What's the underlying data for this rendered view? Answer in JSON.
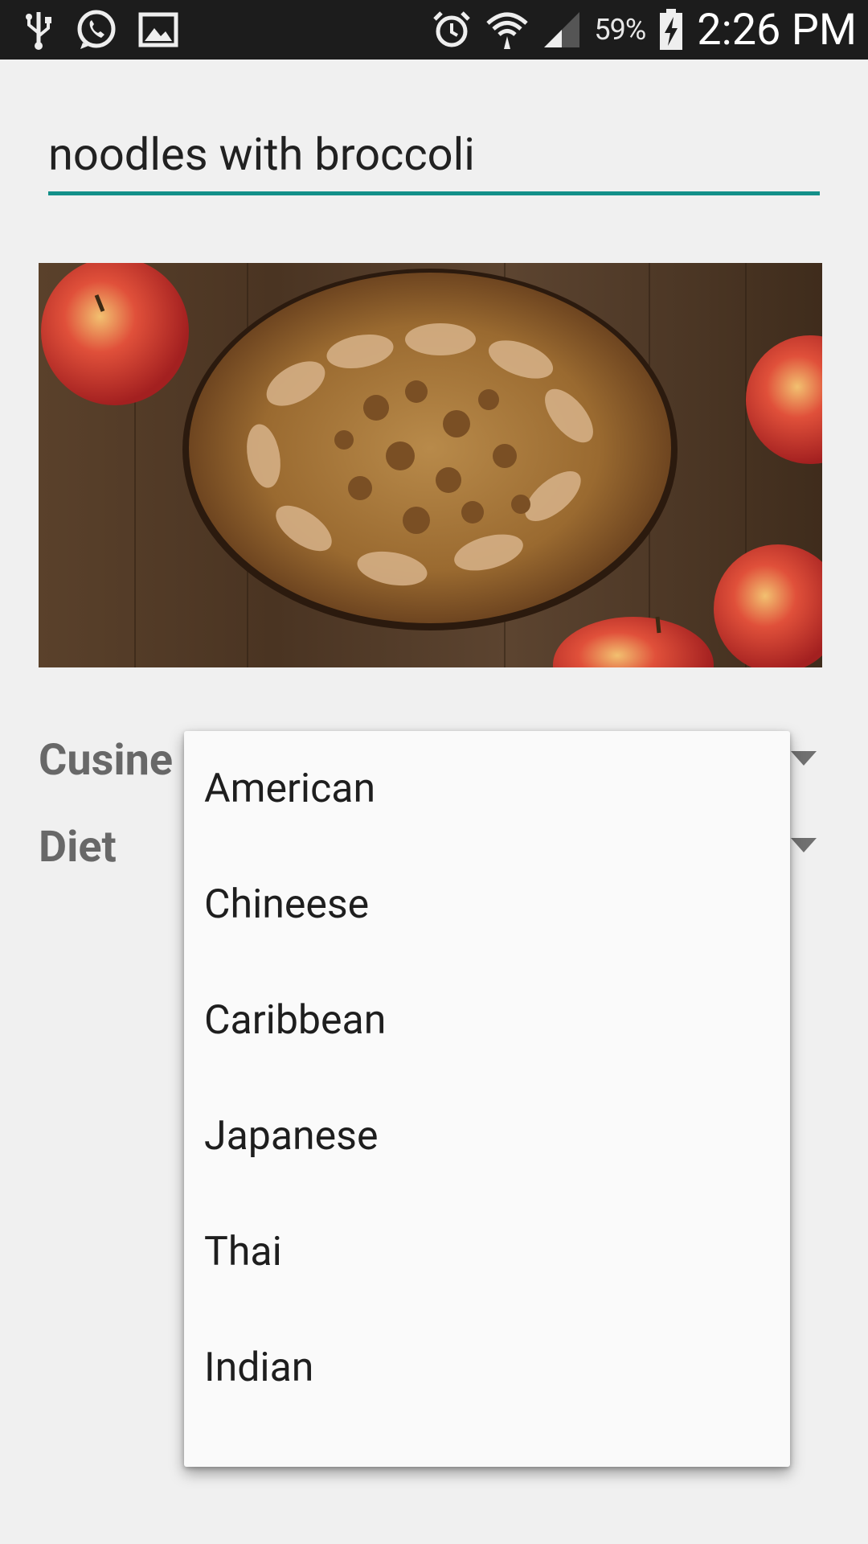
{
  "status_bar": {
    "battery_percent": "59%",
    "time": "2:26 PM",
    "left_icons": [
      "usb-icon",
      "whatsapp-icon",
      "image-icon"
    ],
    "right_icons": [
      "alarm-icon",
      "wifi-icon",
      "signal-icon",
      "battery-charging-icon"
    ]
  },
  "search": {
    "value": "noodles with broccoli",
    "underline_color": "#139089"
  },
  "hero_image": {
    "alt": "recipe-photo"
  },
  "form": {
    "cuisine_label": "Cusine",
    "diet_label": "Diet"
  },
  "dropdown": {
    "options": [
      "American",
      "Chineese",
      "Caribbean",
      "Japanese",
      "Thai",
      "Indian"
    ]
  }
}
